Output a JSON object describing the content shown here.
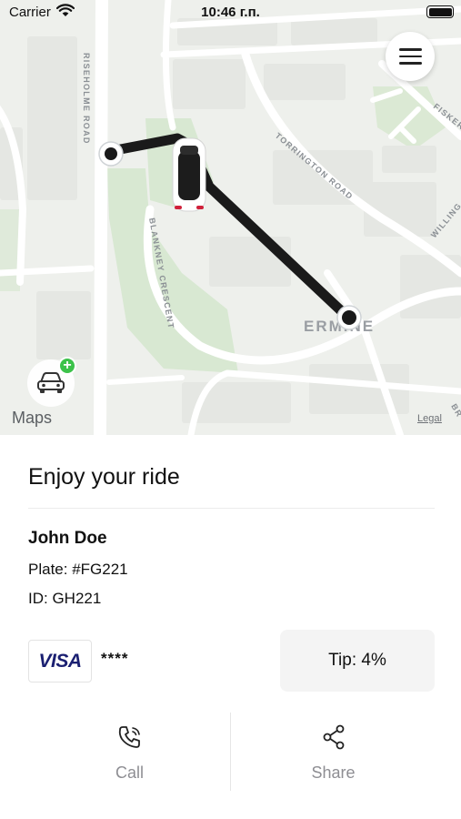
{
  "status_bar": {
    "carrier": "Carrier",
    "time": "10:46 г.п."
  },
  "map": {
    "street_labels": {
      "risholme": "RISEHOLME ROAD",
      "blankney": "BLANKNEY CRESCENT",
      "torrington": "TORRINGTON ROAD",
      "fiskerton": "FISKERT",
      "willingham": "WILLING",
      "br": "BR"
    },
    "district_label": "ERMINE",
    "attribution": "Maps",
    "legal": "Legal",
    "route_color": "#1a1a1a",
    "park_color": "#d8e8d2"
  },
  "ride": {
    "title": "Enjoy your ride",
    "driver_name": "John Doe",
    "plate": "Plate: #FG221",
    "driver_id": "ID: GH221"
  },
  "payment": {
    "card_brand": "VISA",
    "card_masked": "****",
    "tip": "Tip: 4%"
  },
  "actions": {
    "call_label": "Call",
    "share_label": "Share"
  },
  "icons": {
    "menu": "hamburger-menu-icon",
    "car": "car-icon",
    "plus": "plus-icon",
    "phone": "phone-icon",
    "share": "share-icon"
  }
}
